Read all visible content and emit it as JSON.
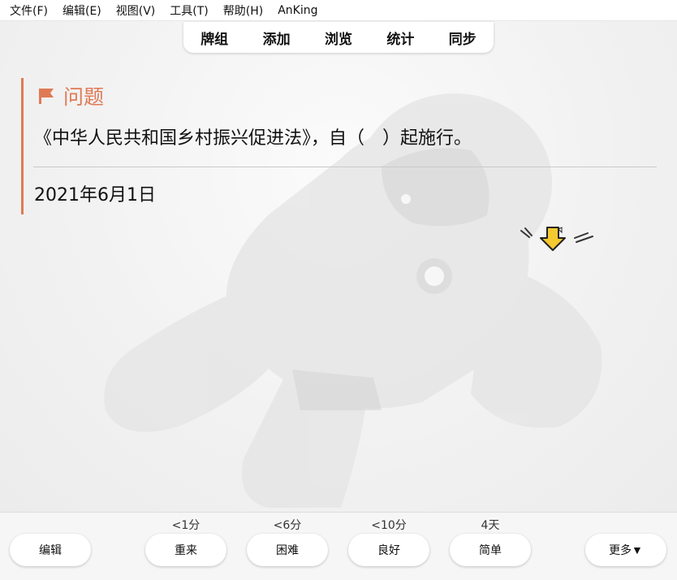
{
  "menu": [
    "文件(F)",
    "编辑(E)",
    "视图(V)",
    "工具(T)",
    "帮助(H)",
    "AnKing"
  ],
  "tabs": [
    "牌组",
    "添加",
    "浏览",
    "统计",
    "同步"
  ],
  "card": {
    "heading": "问题",
    "question": "《中华人民共和国乡村振兴促进法》，自（　）起施行。",
    "answer": "2021年6月1日",
    "accent_color": "#e07a55"
  },
  "bottom": {
    "edit_label": "编辑",
    "more_label": "更多▼",
    "answers": [
      {
        "hint": "<1分",
        "label": "重来"
      },
      {
        "hint": "<6分",
        "label": "困难"
      },
      {
        "hint": "<10分",
        "label": "良好"
      },
      {
        "hint": "4天",
        "label": "简单"
      }
    ]
  },
  "icons": {
    "heading_icon": "flag-icon",
    "sticker": "down-arrow-sticker-icon"
  }
}
